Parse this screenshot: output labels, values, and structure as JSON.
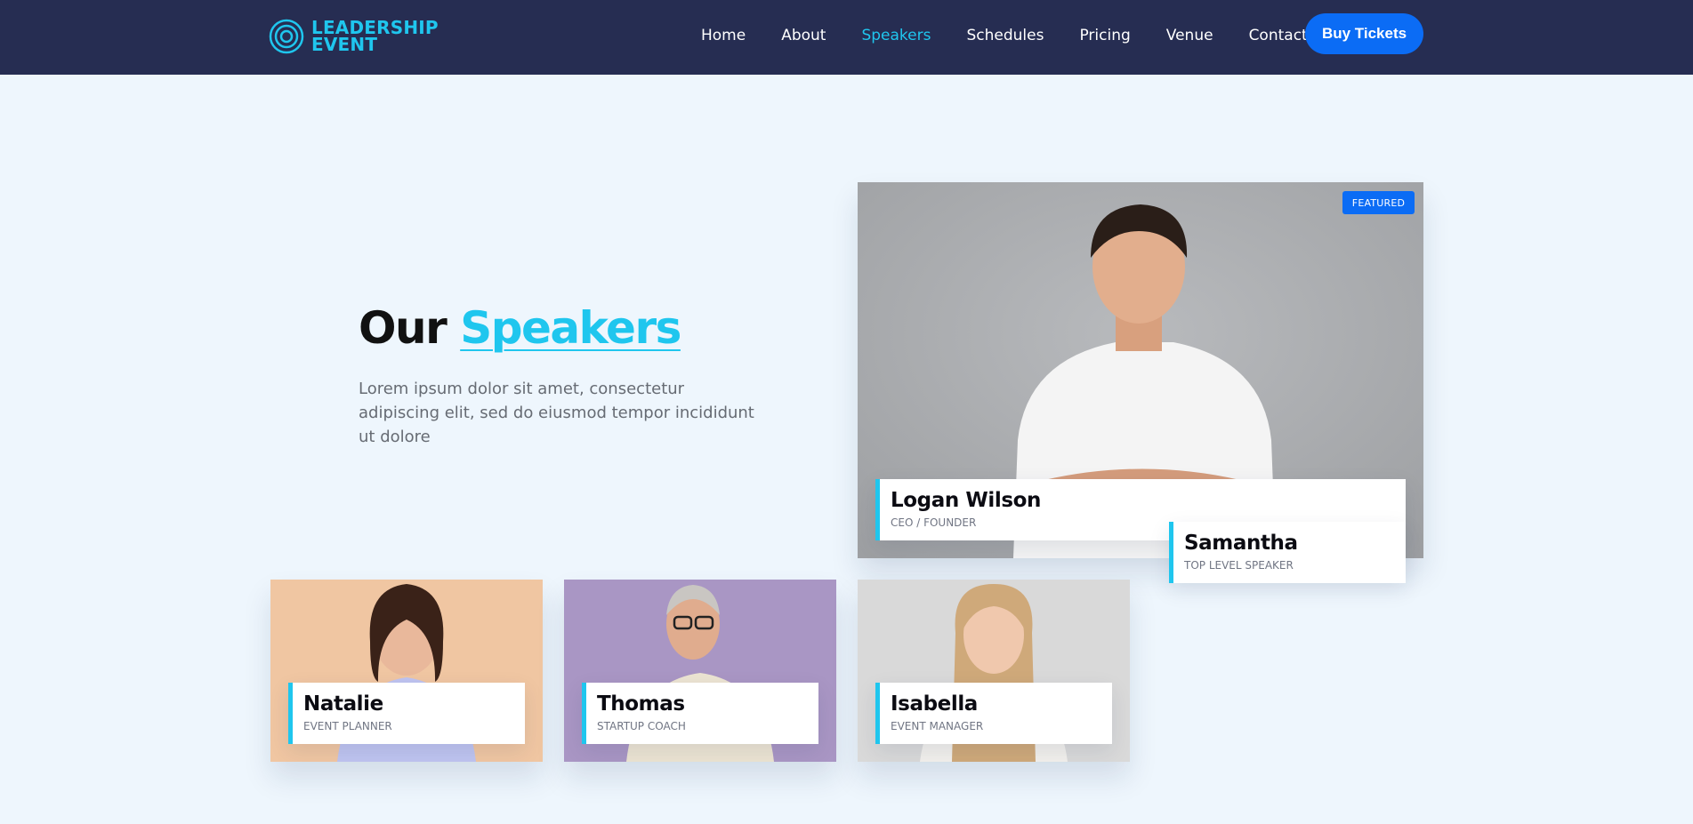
{
  "brand": {
    "line1": "LEADERSHIP",
    "line2": "EVENT",
    "icon": "concentric-circles-icon",
    "color": "#1fc6ee"
  },
  "nav": {
    "items": [
      {
        "label": "Home",
        "active": false
      },
      {
        "label": "About",
        "active": false
      },
      {
        "label": "Speakers",
        "active": true
      },
      {
        "label": "Schedules",
        "active": false
      },
      {
        "label": "Pricing",
        "active": false
      },
      {
        "label": "Venue",
        "active": false
      },
      {
        "label": "Contact",
        "active": false
      }
    ],
    "cta": "Buy Tickets"
  },
  "section": {
    "title_plain": "Our",
    "title_highlight": "Speakers",
    "subtitle": "Lorem ipsum dolor sit amet, consectetur adipiscing elit, sed do eiusmod tempor incididunt ut dolore"
  },
  "featured": {
    "badge": "FEATURED",
    "name": "Logan Wilson",
    "role": "CEO / FOUNDER"
  },
  "overlay": {
    "name": "Samantha",
    "role": "TOP LEVEL SPEAKER"
  },
  "speakers": [
    {
      "name": "Natalie",
      "role": "EVENT PLANNER"
    },
    {
      "name": "Thomas",
      "role": "STARTUP COACH"
    },
    {
      "name": "Isabella",
      "role": "EVENT MANAGER"
    }
  ],
  "colors": {
    "navbar": "#262d52",
    "accent": "#1fc6ee",
    "button": "#0b6cf5",
    "page": "#eef6fd"
  }
}
